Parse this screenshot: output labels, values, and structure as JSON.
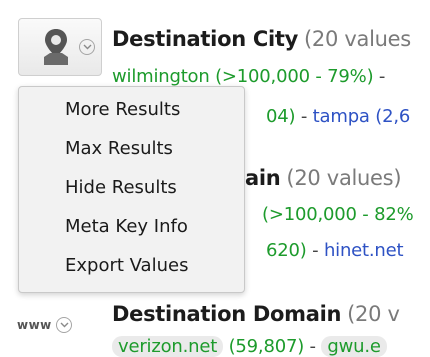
{
  "sections": [
    {
      "title": "Destination City",
      "count": "(20 values",
      "line1": {
        "a": "wilmington (>100,000 - 79%)",
        "sep": " -"
      },
      "line2": {
        "a": "04)",
        "sep": " - ",
        "b": "tampa (2,6"
      }
    },
    {
      "title": "ain",
      "count": "(20 values)",
      "line1": {
        "a": "(>100,000 - 82%"
      },
      "line2": {
        "a": "620)",
        "sep": " - ",
        "b": "hinet.net"
      }
    },
    {
      "title": "Destination Domain",
      "count": "(20 v",
      "label": "www",
      "line1": {
        "a": "verizon.net",
        "b": "(59,807)",
        "sep": " - ",
        "c": "gwu.e"
      }
    }
  ],
  "menu": {
    "items": [
      "More Results",
      "Max Results",
      "Hide Results",
      "Meta Key Info",
      "Export Values"
    ]
  },
  "icons": {
    "section1": "map-pin-icon",
    "dropdown": "chevron-down-icon"
  },
  "colors": {
    "value_green": "#1d9b2c",
    "value_blue": "#2e52c4",
    "title_text": "#1c1c1c",
    "count_gray": "#7a7a7a",
    "menu_bg": "#f2f2f2"
  }
}
